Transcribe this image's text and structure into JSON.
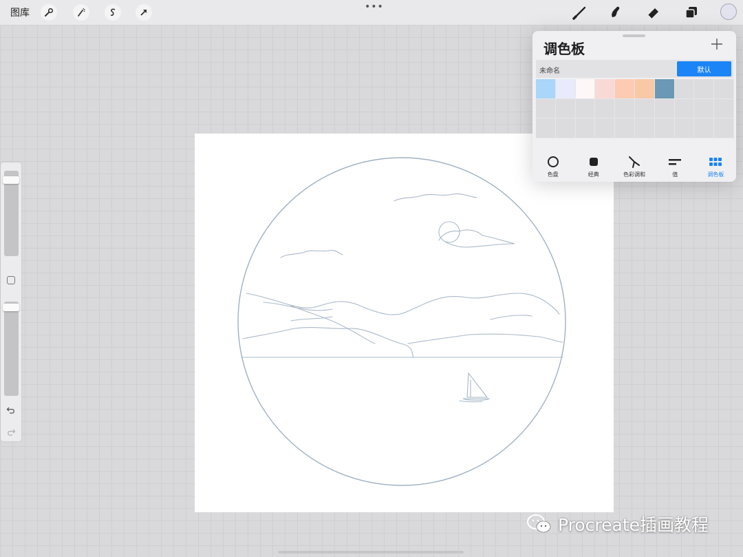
{
  "toolbar": {
    "gallery_label": "图库",
    "left_tools": [
      "wrench-icon",
      "magic-wand-icon",
      "selection-icon",
      "transform-arrow-icon"
    ],
    "more_label": "•••",
    "right_tools": [
      "brush-icon",
      "smudge-icon",
      "eraser-icon",
      "layers-icon"
    ],
    "current_color": "#e3e3ef"
  },
  "sidebar": {
    "size_slider_value": 0.07,
    "opacity_slider_value": 0.02
  },
  "palette_panel": {
    "title": "调色板",
    "palette_name": "未命名",
    "default_label": "默认",
    "swatches": [
      "#a9d6f9",
      "#e8ebfb",
      "#fdf7f7",
      "#f9d9d6",
      "#fdcbb1",
      "#f9c8a5",
      "#6b98b4"
    ],
    "tabs": [
      {
        "label": "色盘",
        "icon": "disc-icon"
      },
      {
        "label": "经典",
        "icon": "square-icon"
      },
      {
        "label": "色彩调和",
        "icon": "harmony-icon"
      },
      {
        "label": "值",
        "icon": "value-bars-icon"
      },
      {
        "label": "调色板",
        "icon": "grid-dots-icon"
      }
    ],
    "active_tab": 4,
    "accent_color": "#1b84f7"
  },
  "watermark": {
    "text": "Procreate插画教程"
  }
}
